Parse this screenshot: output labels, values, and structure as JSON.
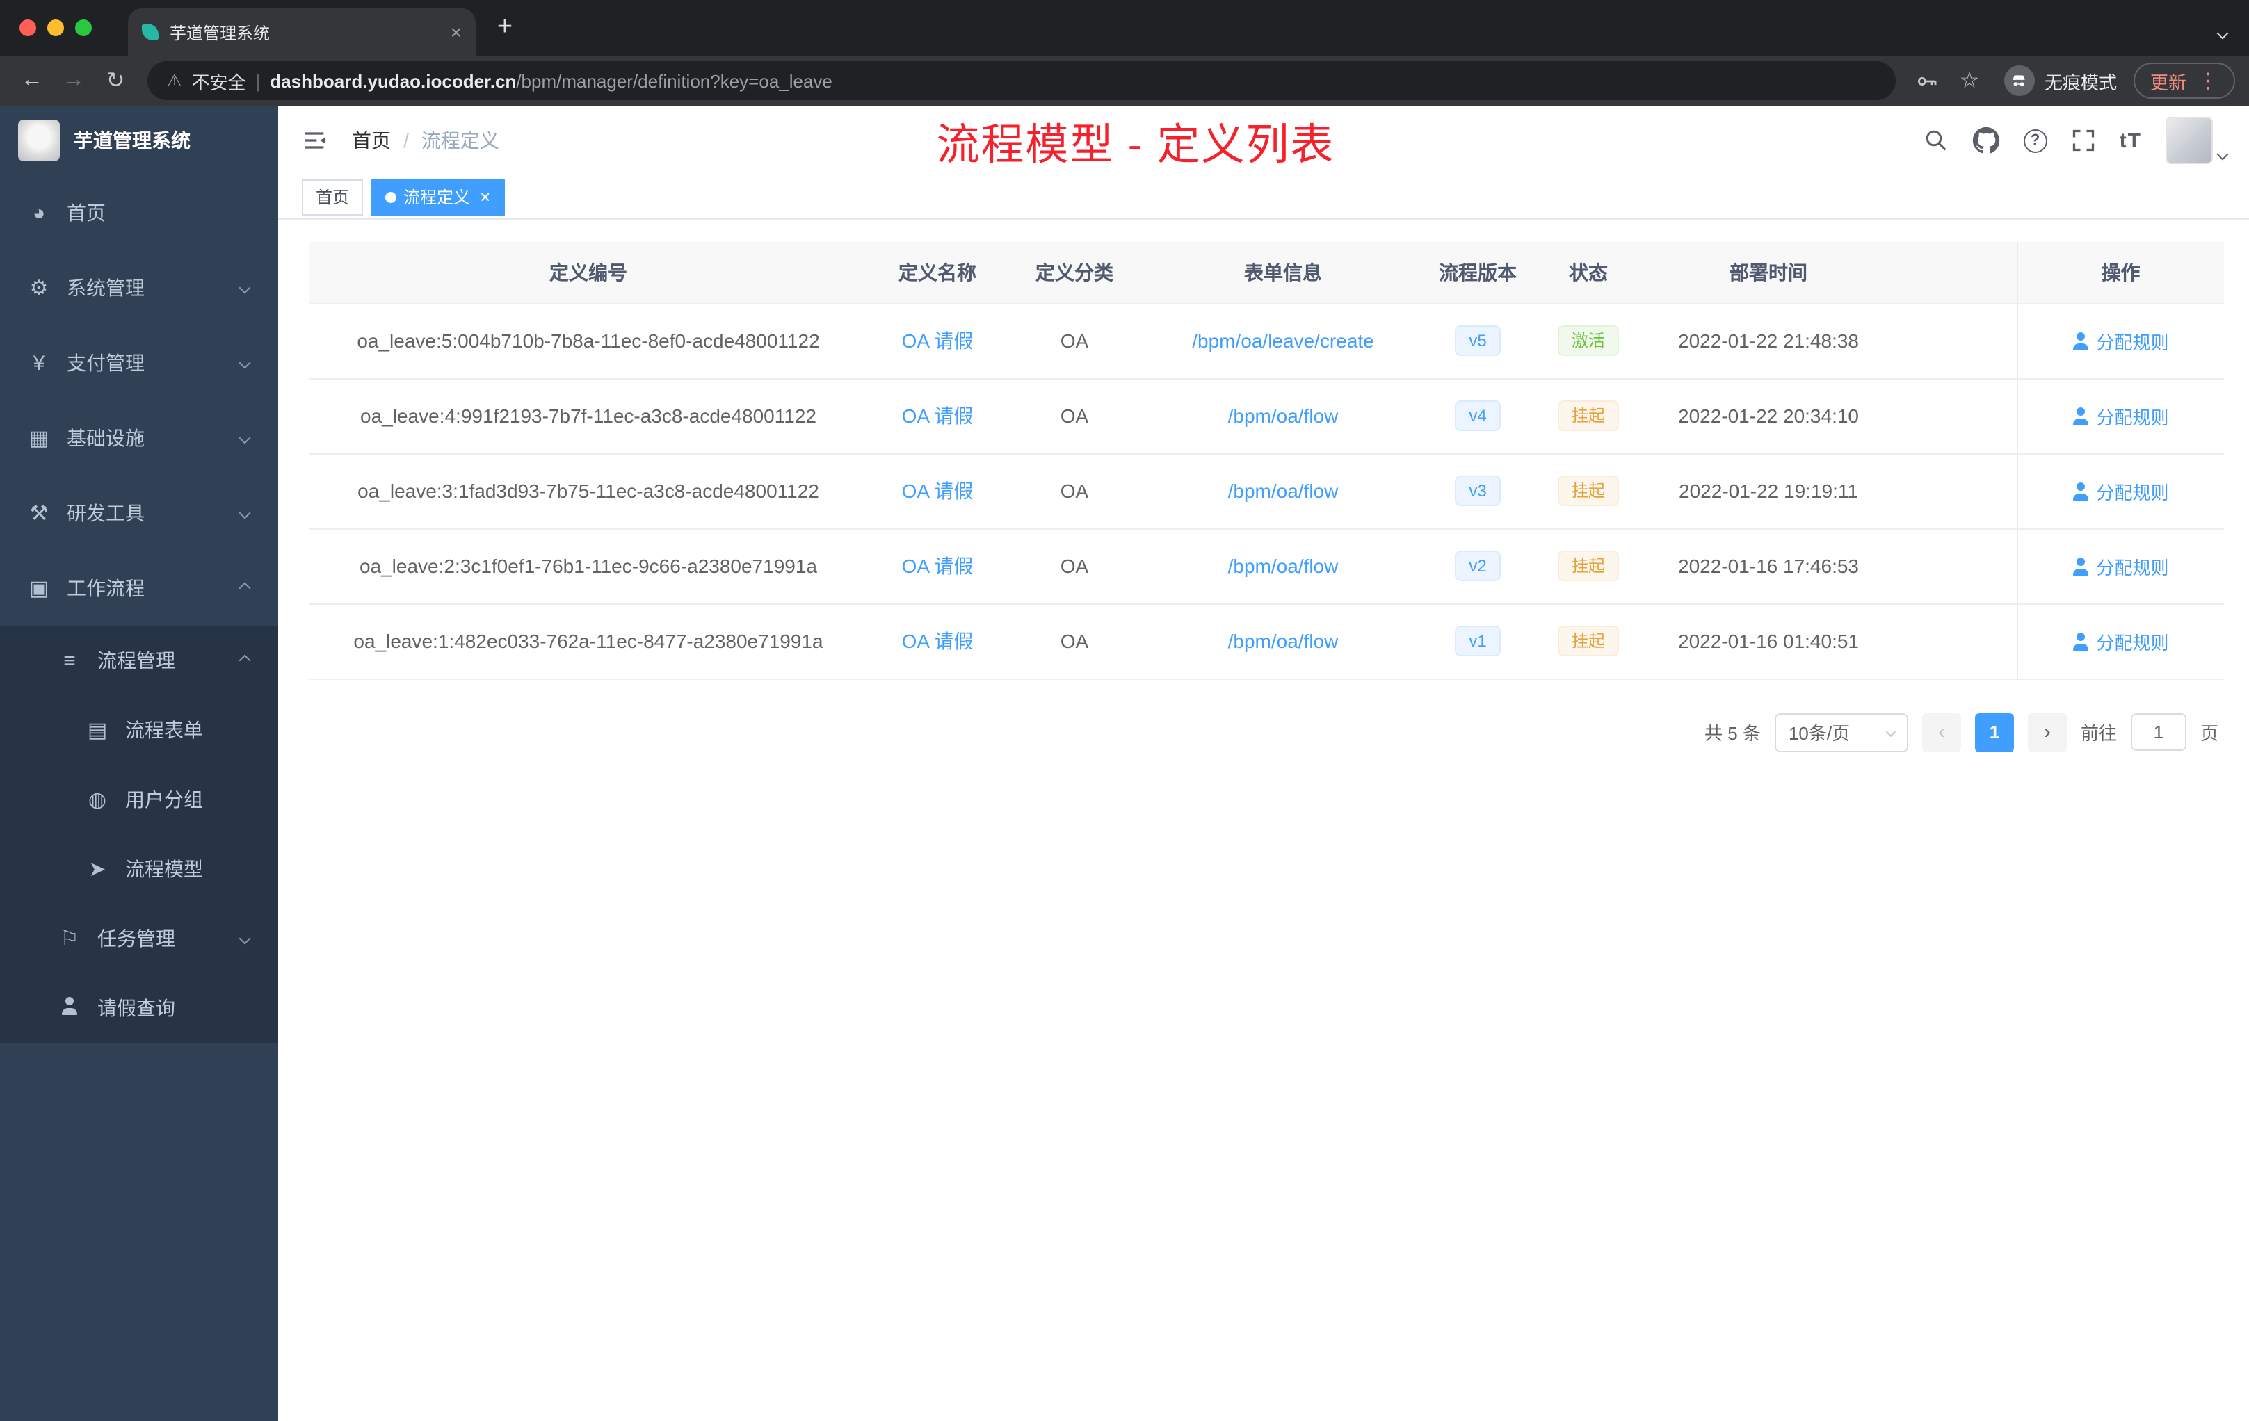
{
  "browser": {
    "tab_title": "芋道管理系统",
    "security_label": "不安全",
    "url_domain": "dashboard.yudao.iocoder.cn",
    "url_path": "/bpm/manager/definition?key=oa_leave",
    "incognito_label": "无痕模式",
    "update_label": "更新"
  },
  "sidebar": {
    "logo_title": "芋道管理系统",
    "items": [
      {
        "key": "home",
        "label": "首页",
        "icon": "dashboard-icon",
        "glyph": "◕",
        "level": 1
      },
      {
        "key": "system",
        "label": "系统管理",
        "icon": "gear-icon",
        "glyph": "⚙",
        "level": 1,
        "chevron": "down"
      },
      {
        "key": "payment",
        "label": "支付管理",
        "icon": "yen-icon",
        "glyph": "¥",
        "level": 1,
        "chevron": "down"
      },
      {
        "key": "infrastructure",
        "label": "基础设施",
        "icon": "monitor-icon",
        "glyph": "▦",
        "level": 1,
        "chevron": "down"
      },
      {
        "key": "devtools",
        "label": "研发工具",
        "icon": "tools-icon",
        "glyph": "⚒",
        "level": 1,
        "chevron": "down"
      },
      {
        "key": "workflow",
        "label": "工作流程",
        "icon": "briefcase-icon",
        "glyph": "▣",
        "level": 1,
        "chevron": "up"
      },
      {
        "key": "process-mgmt",
        "label": "流程管理",
        "icon": "list-icon",
        "glyph": "≡",
        "level": 2,
        "chevron": "up",
        "nested": true
      },
      {
        "key": "process-form",
        "label": "流程表单",
        "icon": "document-icon",
        "glyph": "▤",
        "level": 3,
        "nested": true
      },
      {
        "key": "user-group",
        "label": "用户分组",
        "icon": "chat-icon",
        "glyph": "◍",
        "level": 3,
        "nested": true
      },
      {
        "key": "process-model",
        "label": "流程模型",
        "icon": "send-icon",
        "glyph": "➤",
        "level": 3,
        "nested": true
      },
      {
        "key": "task-mgmt",
        "label": "任务管理",
        "icon": "flag-icon",
        "glyph": "⚐",
        "level": 2,
        "chevron": "down",
        "nested": true
      },
      {
        "key": "leave-query",
        "label": "请假查询",
        "icon": "user-icon",
        "glyph": "@person",
        "level": 2,
        "nested": true
      }
    ]
  },
  "header": {
    "breadcrumb": {
      "home": "首页",
      "separator": "/",
      "current": "流程定义"
    },
    "overlay_title": "流程模型 - 定义列表",
    "text_size_label": "tT"
  },
  "tags": {
    "close_glyph": "×",
    "items": [
      {
        "label": "首页",
        "active": false,
        "closable": false
      },
      {
        "label": "流程定义",
        "active": true,
        "closable": true
      }
    ]
  },
  "table": {
    "columns": [
      "定义编号",
      "定义名称",
      "定义分类",
      "表单信息",
      "流程版本",
      "状态",
      "部署时间",
      "",
      "操作"
    ],
    "rows": [
      {
        "id": "oa_leave:5:004b710b-7b8a-11ec-8ef0-acde48001122",
        "name": "OA 请假",
        "category": "OA",
        "form": "/bpm/oa/leave/create",
        "version": "v5",
        "status": "激活",
        "status_type": "success",
        "time": "2022-01-22 21:48:38",
        "action": "分配规则"
      },
      {
        "id": "oa_leave:4:991f2193-7b7f-11ec-a3c8-acde48001122",
        "name": "OA 请假",
        "category": "OA",
        "form": "/bpm/oa/flow",
        "version": "v4",
        "status": "挂起",
        "status_type": "warning",
        "time": "2022-01-22 20:34:10",
        "action": "分配规则"
      },
      {
        "id": "oa_leave:3:1fad3d93-7b75-11ec-a3c8-acde48001122",
        "name": "OA 请假",
        "category": "OA",
        "form": "/bpm/oa/flow",
        "version": "v3",
        "status": "挂起",
        "status_type": "warning",
        "time": "2022-01-22 19:19:11",
        "action": "分配规则"
      },
      {
        "id": "oa_leave:2:3c1f0ef1-76b1-11ec-9c66-a2380e71991a",
        "name": "OA 请假",
        "category": "OA",
        "form": "/bpm/oa/flow",
        "version": "v2",
        "status": "挂起",
        "status_type": "warning",
        "time": "2022-01-16 17:46:53",
        "action": "分配规则"
      },
      {
        "id": "oa_leave:1:482ec033-762a-11ec-8477-a2380e71991a",
        "name": "OA 请假",
        "category": "OA",
        "form": "/bpm/oa/flow",
        "version": "v1",
        "status": "挂起",
        "status_type": "warning",
        "time": "2022-01-16 01:40:51",
        "action": "分配规则"
      }
    ]
  },
  "pagination": {
    "total": "共 5 条",
    "page_size": "10条/页",
    "prev": "‹",
    "current": "1",
    "next": "›",
    "goto_label": "前往",
    "goto_value": "1",
    "goto_unit": "页"
  },
  "colors": {
    "accent": "#409eff",
    "title_red": "#f5222d",
    "success": "#67c23a",
    "warning": "#e6a23c"
  }
}
